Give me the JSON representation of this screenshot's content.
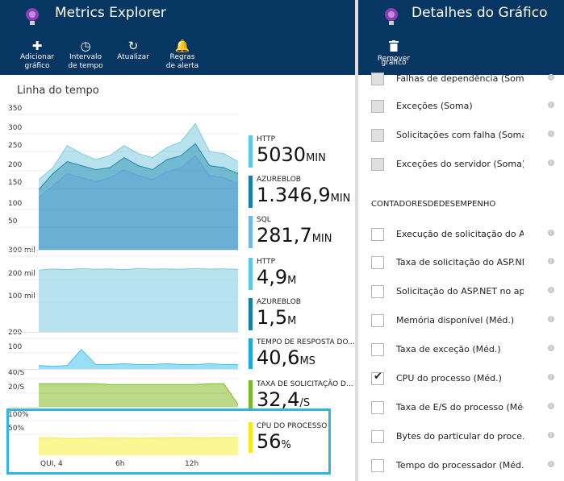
{
  "left_blade": {
    "title": "Metrics Explorer",
    "toolbar": [
      {
        "icon": "plus-icon",
        "glyph": "✚",
        "line1": "Adicionar",
        "line2": "gráfico"
      },
      {
        "icon": "clock-icon",
        "glyph": "◷",
        "line1": "Intervalo",
        "line2": "de tempo"
      },
      {
        "icon": "refresh-icon",
        "glyph": "↻",
        "line1": "Atualizar",
        "line2": ""
      },
      {
        "icon": "bell-icon",
        "glyph": "🔔",
        "line1": "Regras",
        "line2": "de alerta"
      }
    ],
    "panel_title": "Linha do tempo"
  },
  "right_blade": {
    "title": "Detalhes do Gráfico",
    "toolbar": {
      "icon": "trash-icon",
      "line1": "Remover",
      "line2": "gráfico"
    },
    "rows_top": [
      {
        "label": "Falhas de dependência (Soma)",
        "state": "grey"
      },
      {
        "label": "Exceções (Soma)",
        "state": "grey"
      },
      {
        "label": "Solicitações com falha (Soma)",
        "state": "grey"
      },
      {
        "label": "Exceções do servidor (Soma)",
        "state": "grey"
      }
    ],
    "section_title": "CONTADORESDEDESEMPENHO",
    "rows": [
      {
        "label": "Execução de solicitação do A...",
        "state": "empty"
      },
      {
        "label": "Taxa de solicitação do ASP.NE...",
        "state": "empty"
      },
      {
        "label": "Solicitação do ASP.NET no ap...",
        "state": "empty"
      },
      {
        "label": "Memória disponível (Méd.)",
        "state": "empty"
      },
      {
        "label": "Taxa de exceção (Méd.)",
        "state": "empty"
      },
      {
        "label": "CPU do processo (Méd.)",
        "state": "checked"
      },
      {
        "label": "Taxa de E/S do processo (Méd...",
        "state": "empty"
      },
      {
        "label": "Bytes do particular do proce...",
        "state": "empty"
      },
      {
        "label": "Tempo do processador (Méd.)",
        "state": "empty"
      }
    ]
  },
  "colors": {
    "header": "#063661",
    "highlight": "#2fb5e6"
  },
  "chart_data": [
    {
      "type": "area",
      "ylim": [
        0,
        350
      ],
      "yticks": [
        "350",
        "300",
        "250",
        "200",
        "150",
        "100",
        "50"
      ],
      "series": [
        {
          "name": "HTTP",
          "color": "#7ecbe0",
          "values": [
            175,
            205,
            260,
            240,
            225,
            235,
            260,
            240,
            230,
            255,
            270,
            315,
            245,
            240,
            220
          ]
        },
        {
          "name": "AZUREBLOB",
          "color": "#1f8aab",
          "values": [
            150,
            190,
            220,
            210,
            200,
            205,
            230,
            210,
            200,
            225,
            235,
            265,
            210,
            205,
            190
          ]
        },
        {
          "name": "SQL",
          "color": "#5ea3d9",
          "values": [
            130,
            160,
            190,
            180,
            170,
            180,
            200,
            185,
            175,
            195,
            205,
            235,
            185,
            180,
            165
          ]
        }
      ],
      "legend": [
        {
          "name": "HTTP",
          "value": "5030",
          "unit": "MIN",
          "color": "#5bc8e8"
        },
        {
          "name": "AZUREBLOB",
          "value": "1.346,9",
          "unit": "MIN",
          "color": "#1b7ea8"
        },
        {
          "name": "SQL",
          "value": "281,7",
          "unit": "MIN",
          "color": "#71b7e6"
        }
      ]
    },
    {
      "type": "area",
      "ylim": [
        0,
        300000
      ],
      "yticks": [
        "300 mil",
        "200 mil",
        "100 mil"
      ],
      "series": [
        {
          "name": "HTTP",
          "color": "#7ecbe0",
          "values": [
            230000,
            235000,
            232000,
            236000,
            233000,
            235000,
            232000,
            236000,
            234000,
            235000,
            233000,
            236000,
            234000,
            235000,
            233000
          ]
        },
        {
          "name": "AZUREBLOB",
          "color": "#b9e3f2",
          "values": [
            200000,
            203000,
            201000,
            204000,
            202000,
            203000,
            201000,
            204000,
            202000,
            203000,
            201000,
            204000,
            202000,
            203000,
            201000
          ]
        }
      ],
      "legend": [
        {
          "name": "HTTP",
          "value": "4,9",
          "unit": "M",
          "color": "#5bc8e8"
        },
        {
          "name": "AZUREBLOB",
          "value": "1,5",
          "unit": "M",
          "color": "#1b7ea8"
        }
      ]
    },
    {
      "type": "area",
      "ylim": [
        0,
        200
      ],
      "yticks": [
        "200",
        "100"
      ],
      "series": [
        {
          "name": "TEMPO DE RESPOSTA DO...",
          "color": "#47c2ec",
          "values": [
            20,
            15,
            20,
            110,
            25,
            25,
            30,
            25,
            25,
            30,
            25,
            25,
            30,
            25,
            25
          ]
        }
      ],
      "legend": [
        {
          "name": "TEMPO DE RESPOSTA DO...",
          "value": "40,6",
          "unit": "MS",
          "color": "#1ea7e0"
        }
      ]
    },
    {
      "type": "area",
      "ylim": [
        0,
        40
      ],
      "yticks": [
        "40/S",
        "20/S"
      ],
      "series": [
        {
          "name": "TAXA DE SOLICITAÇÃO D...",
          "color": "#84b924",
          "values": [
            28,
            28,
            28,
            28,
            28,
            27,
            27,
            27,
            27,
            27,
            27,
            27,
            28,
            28,
            3
          ]
        }
      ],
      "legend": [
        {
          "name": "TAXA DE SOLICITAÇÃO D...",
          "value": "32,4",
          "unit": "/S",
          "color": "#7ab92e"
        }
      ]
    },
    {
      "type": "area",
      "ylim": [
        0,
        100
      ],
      "yticks": [
        "100%",
        "50%"
      ],
      "series": [
        {
          "name": "CPU DO PROCESSO",
          "color": "#f5ee3c",
          "values": [
            42,
            42,
            41,
            41,
            42,
            42,
            42,
            41,
            42,
            42,
            43,
            42,
            42,
            43,
            43
          ]
        }
      ],
      "legend": [
        {
          "name": "CPU DO PROCESSO",
          "value": "56",
          "unit": "%",
          "color": "#f5ea1e"
        }
      ]
    }
  ],
  "x_ticks": [
    "QUI, 4",
    "6h",
    "12h"
  ]
}
